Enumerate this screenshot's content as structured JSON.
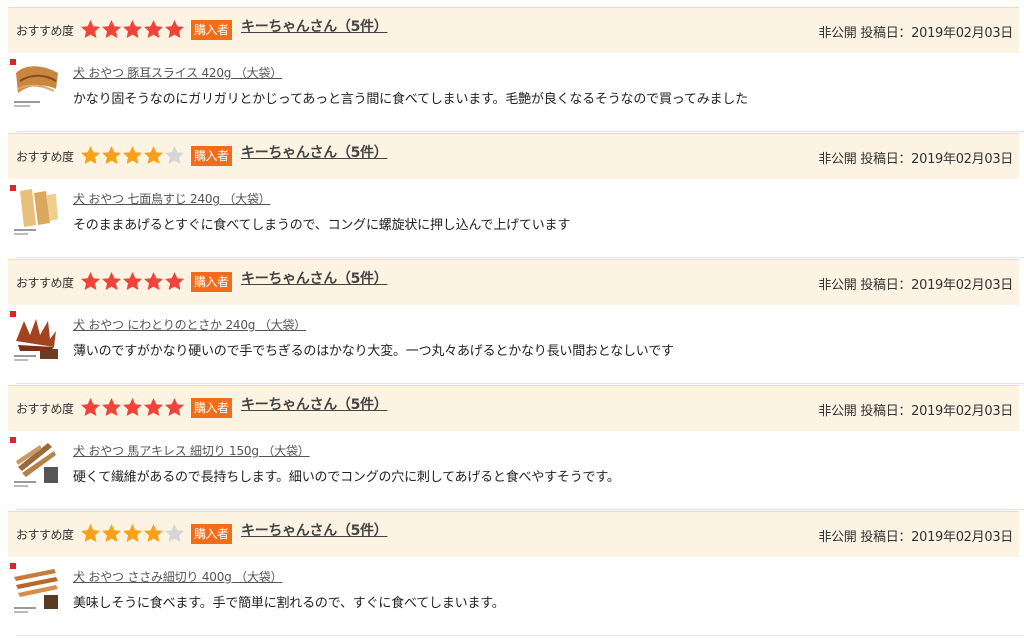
{
  "colors": {
    "header_bg": "#fdf3e3",
    "star_red": "#f0433a",
    "star_orange": "#f7a11a",
    "star_empty": "#d6d6d6",
    "badge_bg": "#f26c1a"
  },
  "reviews": [
    {
      "rec_label": "おすすめ度",
      "rating": 5,
      "buyer_badge": "購入者",
      "reviewer": "キーちゃんさん（5件）",
      "visibility": "非公開",
      "date": "投稿日：2019年02月03日",
      "thumb_icon": "pork-ear-slices-image",
      "product": "犬 おやつ 豚耳スライス 420g （大袋）",
      "comment": "かなり固そうなのにガリガリとかじってあっと言う間に食べてしまいます。毛艶が良くなるそうなので買ってみました"
    },
    {
      "rec_label": "おすすめ度",
      "rating": 4,
      "buyer_badge": "購入者",
      "reviewer": "キーちゃんさん（5件）",
      "visibility": "非公開",
      "date": "投稿日：2019年02月03日",
      "thumb_icon": "turkey-tendon-image",
      "product": "犬 おやつ 七面鳥すじ 240g （大袋）",
      "comment": "そのままあげるとすぐに食べてしまうので、コングに螺旋状に押し込んで上げています"
    },
    {
      "rec_label": "おすすめ度",
      "rating": 5,
      "buyer_badge": "購入者",
      "reviewer": "キーちゃんさん（5件）",
      "visibility": "非公開",
      "date": "投稿日：2019年02月03日",
      "thumb_icon": "chicken-comb-image",
      "product": "犬 おやつ にわとりのとさか 240g （大袋）",
      "comment": "薄いのですがかなり硬いので手でちぎるのはかなり大変。一つ丸々あげるとかなり長い間おとなしいです"
    },
    {
      "rec_label": "おすすめ度",
      "rating": 5,
      "buyer_badge": "購入者",
      "reviewer": "キーちゃんさん（5件）",
      "visibility": "非公開",
      "date": "投稿日：2019年02月03日",
      "thumb_icon": "horse-achilles-image",
      "product": "犬 おやつ 馬アキレス 細切り 150g （大袋）",
      "comment": "硬くて繊維があるので長持ちします。細いのでコングの穴に刺してあげると食べやすそうです。"
    },
    {
      "rec_label": "おすすめ度",
      "rating": 4,
      "buyer_badge": "購入者",
      "reviewer": "キーちゃんさん（5件）",
      "visibility": "非公開",
      "date": "投稿日：2019年02月03日",
      "thumb_icon": "chicken-fillet-strips-image",
      "product": "犬 おやつ ささみ細切り 400g （大袋）",
      "comment": "美味しそうに食べます。手で簡単に割れるので、すぐに食べてしまいます。"
    }
  ]
}
